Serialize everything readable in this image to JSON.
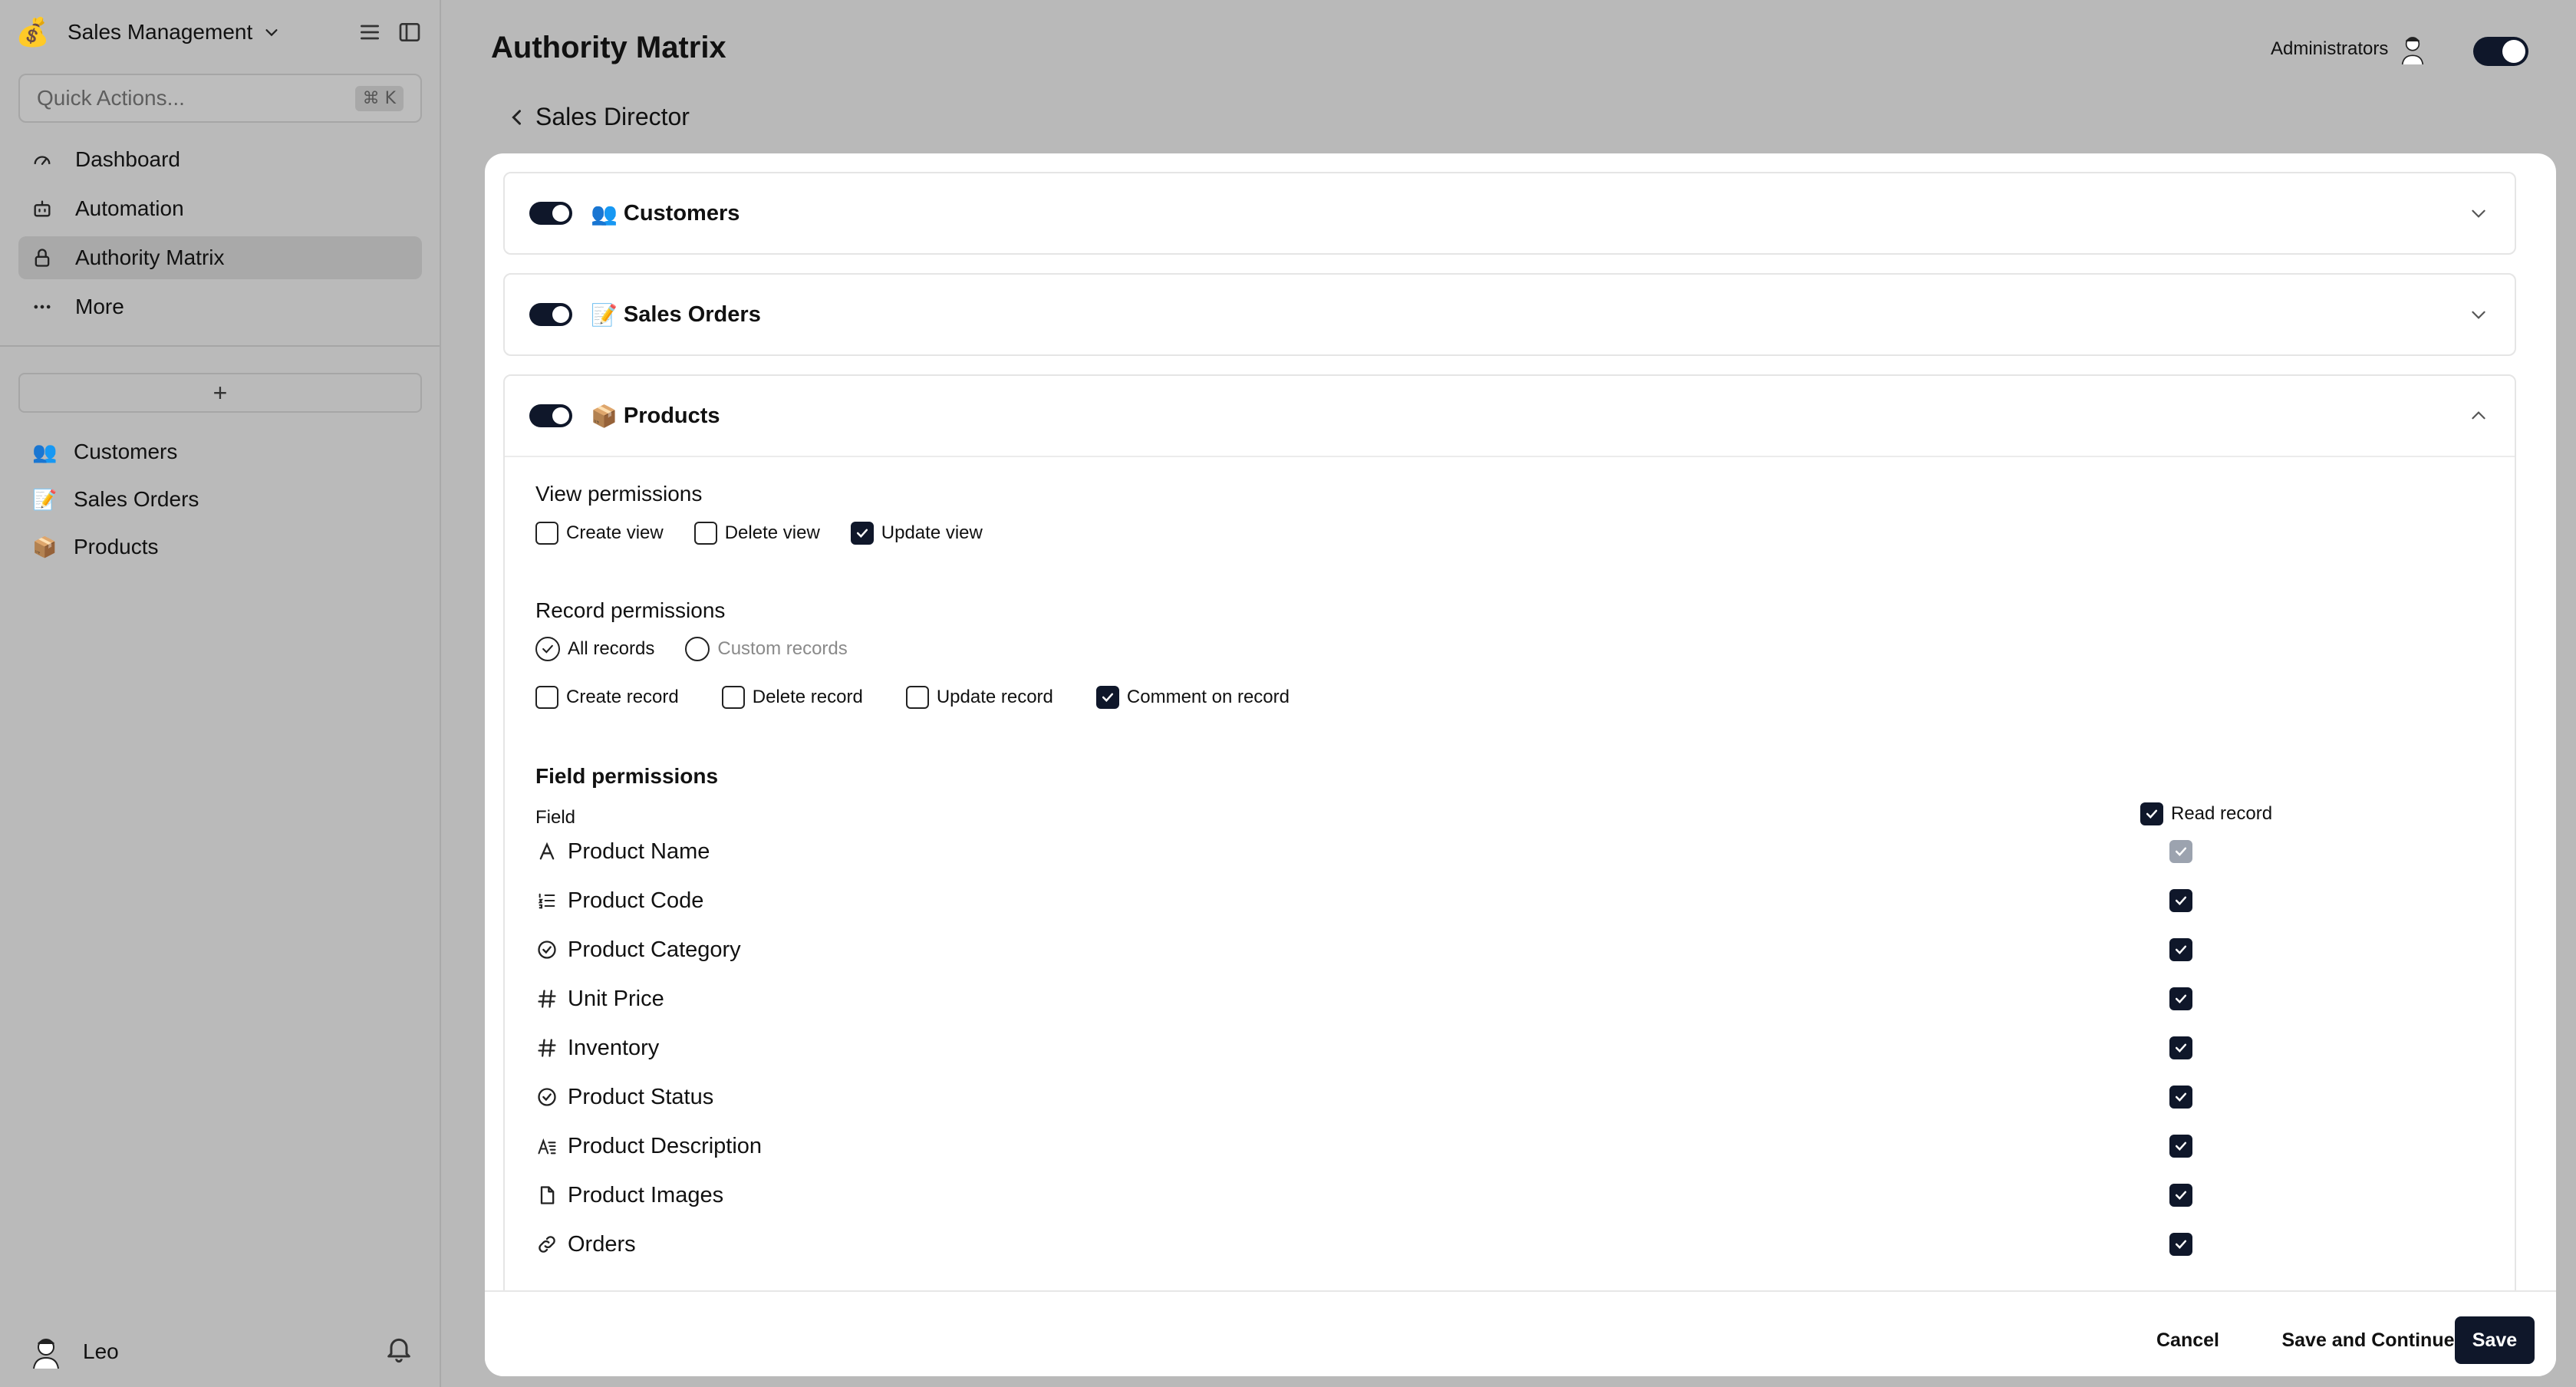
{
  "workspace": {
    "name": "Sales Management",
    "logo": "money-bag-emoji"
  },
  "quick_actions": {
    "placeholder": "Quick Actions...",
    "shortcut": "⌘ K"
  },
  "nav": [
    {
      "label": "Dashboard",
      "icon": "gauge-icon"
    },
    {
      "label": "Automation",
      "icon": "bot-icon"
    },
    {
      "label": "Authority Matrix",
      "icon": "lock-icon",
      "active": true
    },
    {
      "label": "More",
      "icon": "more-icon"
    }
  ],
  "add_label": "+",
  "tables": [
    {
      "emoji": "👥",
      "label": "Customers"
    },
    {
      "emoji": "📝",
      "label": "Sales Orders"
    },
    {
      "emoji": "📦",
      "label": "Products"
    }
  ],
  "user": {
    "name": "Leo"
  },
  "header": {
    "title": "Authority Matrix",
    "back_label": "Sales Director",
    "role_label": "Administrators"
  },
  "sections": [
    {
      "emoji": "👥",
      "label": "Customers",
      "expanded": false
    },
    {
      "emoji": "📝",
      "label": "Sales Orders",
      "expanded": false
    },
    {
      "emoji": "📦",
      "label": "Products",
      "expanded": true
    }
  ],
  "view_permissions": {
    "title": "View permissions",
    "items": [
      {
        "label": "Create view",
        "checked": false
      },
      {
        "label": "Delete view",
        "checked": false
      },
      {
        "label": "Update view",
        "checked": true
      }
    ]
  },
  "record_permissions": {
    "title": "Record permissions",
    "scope": [
      {
        "label": "All records",
        "selected": true
      },
      {
        "label": "Custom records",
        "selected": false
      }
    ],
    "items": [
      {
        "label": "Create record",
        "checked": false
      },
      {
        "label": "Delete record",
        "checked": false
      },
      {
        "label": "Update record",
        "checked": false
      },
      {
        "label": "Comment on record",
        "checked": true
      }
    ]
  },
  "field_permissions": {
    "title": "Field permissions",
    "field_col": "Field",
    "read_col": "Read record",
    "fields": [
      {
        "label": "Product Name",
        "icon": "text-icon",
        "read": "disabled-checked"
      },
      {
        "label": "Product Code",
        "icon": "numbered-list-icon",
        "read": "checked"
      },
      {
        "label": "Product Category",
        "icon": "circle-check-icon",
        "read": "checked"
      },
      {
        "label": "Unit Price",
        "icon": "hash-icon",
        "read": "checked"
      },
      {
        "label": "Inventory",
        "icon": "hash-icon",
        "read": "checked"
      },
      {
        "label": "Product Status",
        "icon": "circle-check-icon",
        "read": "checked"
      },
      {
        "label": "Product Description",
        "icon": "long-text-icon",
        "read": "checked"
      },
      {
        "label": "Product Images",
        "icon": "file-icon",
        "read": "checked"
      },
      {
        "label": "Orders",
        "icon": "link-icon",
        "read": "checked"
      }
    ]
  },
  "footer": {
    "cancel": "Cancel",
    "save_continue": "Save and Continue",
    "save": "Save"
  },
  "colors": {
    "primary": "#0f172a",
    "overlay": "#b9b9b9"
  }
}
